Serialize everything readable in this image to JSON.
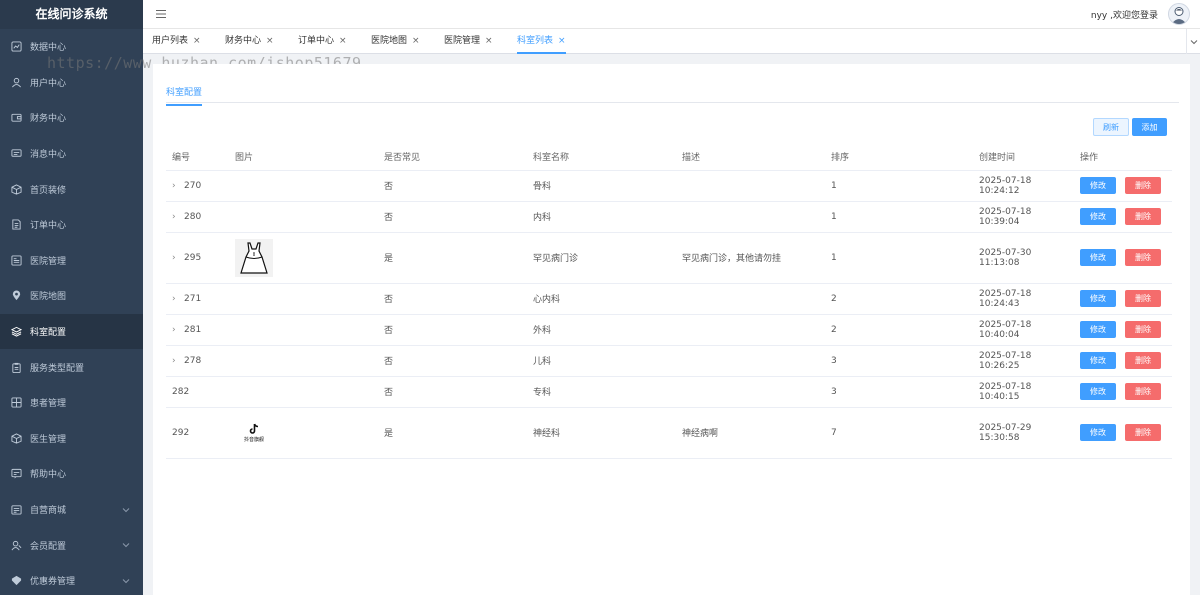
{
  "app": {
    "title": "在线问诊系统"
  },
  "sidebar": {
    "items": [
      {
        "label": "数据中心",
        "icon": "dashboard-icon",
        "expandable": false
      },
      {
        "label": "用户中心",
        "icon": "user-icon",
        "expandable": false
      },
      {
        "label": "财务中心",
        "icon": "wallet-icon",
        "expandable": false
      },
      {
        "label": "消息中心",
        "icon": "message-icon",
        "expandable": false
      },
      {
        "label": "首页装修",
        "icon": "box-icon",
        "expandable": false
      },
      {
        "label": "订单中心",
        "icon": "document-icon",
        "expandable": false
      },
      {
        "label": "医院管理",
        "icon": "hospital-icon",
        "expandable": false
      },
      {
        "label": "医院地图",
        "icon": "location-icon",
        "expandable": false
      },
      {
        "label": "科室配置",
        "icon": "layers-icon",
        "expandable": false,
        "active": true
      },
      {
        "label": "服务类型配置",
        "icon": "clipboard-icon",
        "expandable": false
      },
      {
        "label": "患者管理",
        "icon": "grid-icon",
        "expandable": false
      },
      {
        "label": "医生管理",
        "icon": "box-icon",
        "expandable": false
      },
      {
        "label": "帮助中心",
        "icon": "help-icon",
        "expandable": false
      },
      {
        "label": "自营商城",
        "icon": "shop-icon",
        "expandable": true
      },
      {
        "label": "会员配置",
        "icon": "member-icon",
        "expandable": true
      },
      {
        "label": "优惠券管理",
        "icon": "coupon-icon",
        "expandable": true
      }
    ]
  },
  "header": {
    "welcome": "nyy ,欢迎您登录",
    "menu_icon": "hamburger-icon",
    "avatar_icon": "avatar-icon"
  },
  "tabs": [
    {
      "label": "用户列表",
      "active": false
    },
    {
      "label": "财务中心",
      "active": false
    },
    {
      "label": "订单中心",
      "active": false
    },
    {
      "label": "医院地图",
      "active": false
    },
    {
      "label": "医院管理",
      "active": false
    },
    {
      "label": "科室列表",
      "active": true
    }
  ],
  "watermark": "https://www.huzhan.com/ishop51679",
  "main": {
    "subtab": "科室配置",
    "refresh_label": "刷新",
    "add_label": "添加",
    "columns": [
      "编号",
      "图片",
      "是否常见",
      "科室名称",
      "描述",
      "排序",
      "创建时间",
      "操作"
    ],
    "edit_label": "修改",
    "delete_label": "删除",
    "rows": [
      {
        "id": "270",
        "expandable": true,
        "image": "",
        "common": "否",
        "name": "骨科",
        "desc": "",
        "sort": "1",
        "created": "2025-07-18 10:24:12"
      },
      {
        "id": "280",
        "expandable": true,
        "image": "",
        "common": "否",
        "name": "内科",
        "desc": "",
        "sort": "1",
        "created": "2025-07-18 10:39:04"
      },
      {
        "id": "295",
        "expandable": true,
        "image": "dress-icon",
        "common": "是",
        "name": "罕见病门诊",
        "desc": "罕见病门诊，其他请勿挂",
        "sort": "1",
        "created": "2025-07-30 11:13:08"
      },
      {
        "id": "271",
        "expandable": true,
        "image": "",
        "common": "否",
        "name": "心内科",
        "desc": "",
        "sort": "2",
        "created": "2025-07-18 10:24:43"
      },
      {
        "id": "281",
        "expandable": true,
        "image": "",
        "common": "否",
        "name": "外科",
        "desc": "",
        "sort": "2",
        "created": "2025-07-18 10:40:04"
      },
      {
        "id": "278",
        "expandable": true,
        "image": "",
        "common": "否",
        "name": "儿科",
        "desc": "",
        "sort": "3",
        "created": "2025-07-18 10:26:25"
      },
      {
        "id": "282",
        "expandable": false,
        "image": "",
        "common": "否",
        "name": "专科",
        "desc": "",
        "sort": "3",
        "created": "2025-07-18 10:40:15"
      },
      {
        "id": "292",
        "expandable": false,
        "image": "douyin-logo",
        "image_caption": "抖音旗舰",
        "common": "是",
        "name": "神经科",
        "desc": "神经病啊",
        "sort": "7",
        "created": "2025-07-29 15:30:58"
      }
    ]
  },
  "colors": {
    "sidebar_bg": "#304156",
    "accent": "#409eff",
    "danger": "#f56c6c"
  }
}
